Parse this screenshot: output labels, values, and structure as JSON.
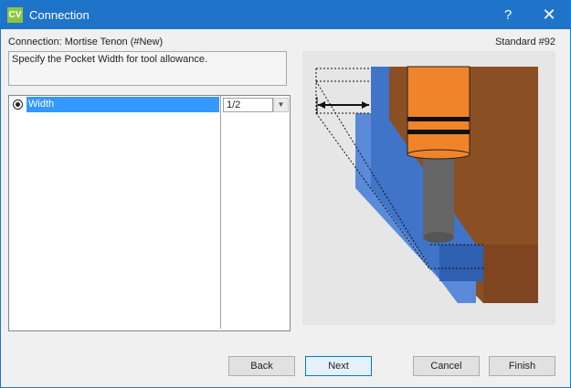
{
  "window": {
    "logo": "CV",
    "title": "Connection",
    "help": "?",
    "close": "✕"
  },
  "header": {
    "connection": "Connection: Mortise  Tenon (#New)",
    "standard": "Standard #92"
  },
  "description": "Specify the Pocket Width for tool allowance.",
  "grid": {
    "rows": [
      {
        "label": "Width",
        "value": "1/2",
        "selected": true
      }
    ]
  },
  "buttons": {
    "back": "Back",
    "next": "Next",
    "cancel": "Cancel",
    "finish": "Finish"
  },
  "illustration": {
    "wood_color": "#8b4f24",
    "pocket_color": "#3f74c9",
    "tool_color": "#f0842a",
    "shank_color": "#666666"
  }
}
